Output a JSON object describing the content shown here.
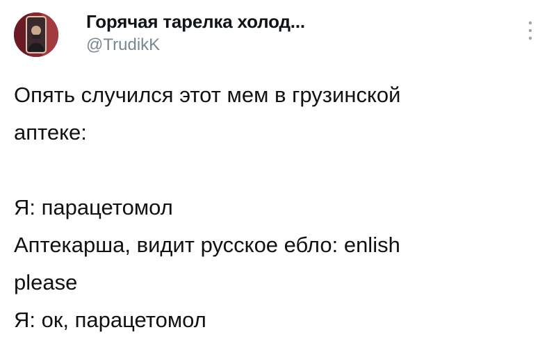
{
  "author": {
    "display_name": "Горячая тарелка холод...",
    "handle": "@TrudikK",
    "avatar_icon": "user-photo-avatar"
  },
  "actions": {
    "more_icon": "more-vertical-icon"
  },
  "tweet": {
    "lines": [
      "Опять случился этот мем в грузинской",
      "аптеке:",
      "",
      "Я: парацетомол",
      "Аптекарша, видит русское ебло: enlish",
      "please",
      "Я: ок, парацетомол"
    ]
  },
  "colors": {
    "text": "#0f1419",
    "muted": "#7a8791",
    "background": "#ffffff"
  }
}
